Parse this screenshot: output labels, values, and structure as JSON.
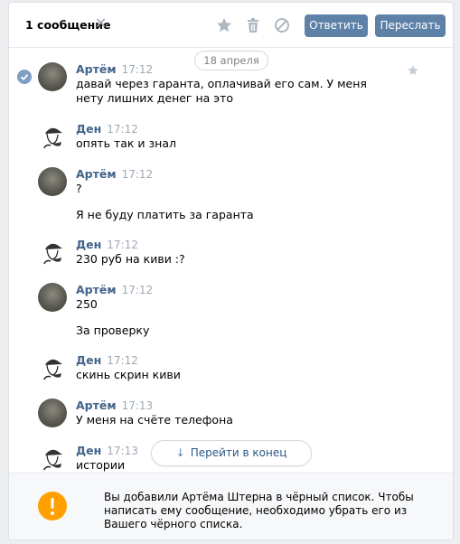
{
  "header": {
    "selection_count": "1 сообщение",
    "close_symbol": "✕",
    "reply_label": "Ответить",
    "forward_label": "Переслать",
    "icons": [
      "star-icon",
      "trash-icon",
      "block-icon"
    ]
  },
  "date_separator": "18 апреля",
  "messages": [
    {
      "author": "Артём",
      "time": "17:12",
      "text": "давай через гаранта, оплачивай его сам. У меня нету лишних денег на это",
      "avatar": "photo",
      "selected": true
    },
    {
      "author": "Ден",
      "time": "17:12",
      "text": "опять так и знал",
      "avatar": "detective"
    },
    {
      "author": "Артём",
      "time": "17:12",
      "text": "?",
      "text2": "Я не буду платить за гаранта",
      "avatar": "photo"
    },
    {
      "author": "Ден",
      "time": "17:12",
      "text": "230 руб на киви :?",
      "avatar": "detective"
    },
    {
      "author": "Артём",
      "time": "17:12",
      "text": "250",
      "text2": "За проверку",
      "avatar": "photo"
    },
    {
      "author": "Ден",
      "time": "17:12",
      "text": "скинь скрин киви",
      "avatar": "detective"
    },
    {
      "author": "Артём",
      "time": "17:13",
      "text": "У меня на счёте телефона",
      "avatar": "photo"
    },
    {
      "author": "Ден",
      "time": "17:13",
      "text": "истории",
      "avatar": "detective"
    }
  ],
  "jump_to_end_label": "Перейти в конец истории",
  "footer": {
    "warning_text": "Вы добавили Артёма Штерна в чёрный список. Чтобы написать ему сообщение, необходимо убрать его из Вашего чёрного списка."
  },
  "colors": {
    "accent": "#5e81a8",
    "author": "#42648b",
    "warning": "#ffa000"
  }
}
